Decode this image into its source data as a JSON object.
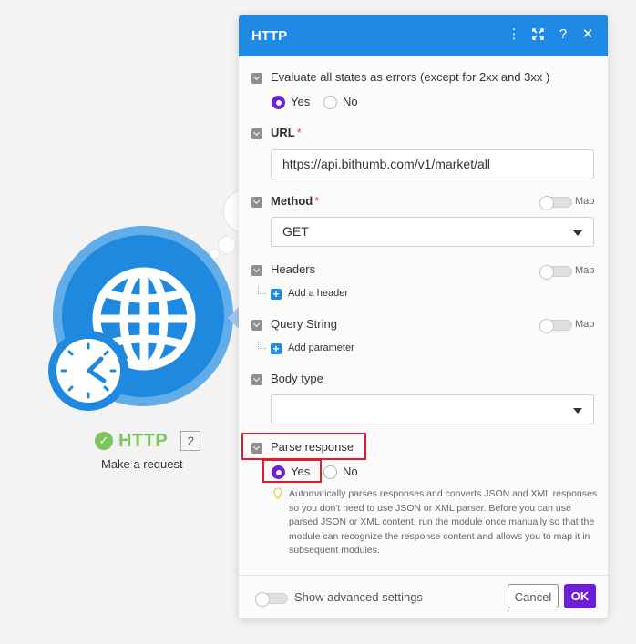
{
  "module": {
    "name": "HTTP",
    "id_badge": "2",
    "subtitle": "Make a request"
  },
  "panel": {
    "title": "HTTP",
    "header_icons": [
      "more-vertical-icon",
      "expand-icon",
      "help-icon",
      "close-icon"
    ],
    "evaluate_errors": {
      "label": "Evaluate all states as errors (except for 2xx and 3xx )",
      "yes": "Yes",
      "no": "No",
      "selected": "Yes"
    },
    "url": {
      "label": "URL",
      "required_mark": "*",
      "value": "https://api.bithumb.com/v1/market/all"
    },
    "method": {
      "label": "Method",
      "required_mark": "*",
      "value": "GET",
      "map_label": "Map"
    },
    "headers": {
      "label": "Headers",
      "add_label": "Add a header",
      "map_label": "Map"
    },
    "query_string": {
      "label": "Query String",
      "add_label": "Add parameter",
      "map_label": "Map"
    },
    "body_type": {
      "label": "Body type",
      "value": ""
    },
    "parse_response": {
      "label": "Parse response",
      "yes": "Yes",
      "no": "No",
      "selected": "Yes",
      "help": "Automatically parses responses and converts JSON and XML responses so you don't need to use JSON or XML parser. Before you can use parsed JSON or XML content, run the module once manually so that the module can recognize the response content and allows you to map it in subsequent modules."
    },
    "footer": {
      "advanced_label": "Show advanced settings",
      "cancel_label": "Cancel",
      "ok_label": "OK"
    }
  },
  "colors": {
    "header_blue": "#1f8ae6",
    "module_blue": "#1f88df",
    "success_green": "#7cc45b",
    "accent_purple": "#6c1fd6",
    "highlight_red": "#e5192b"
  }
}
